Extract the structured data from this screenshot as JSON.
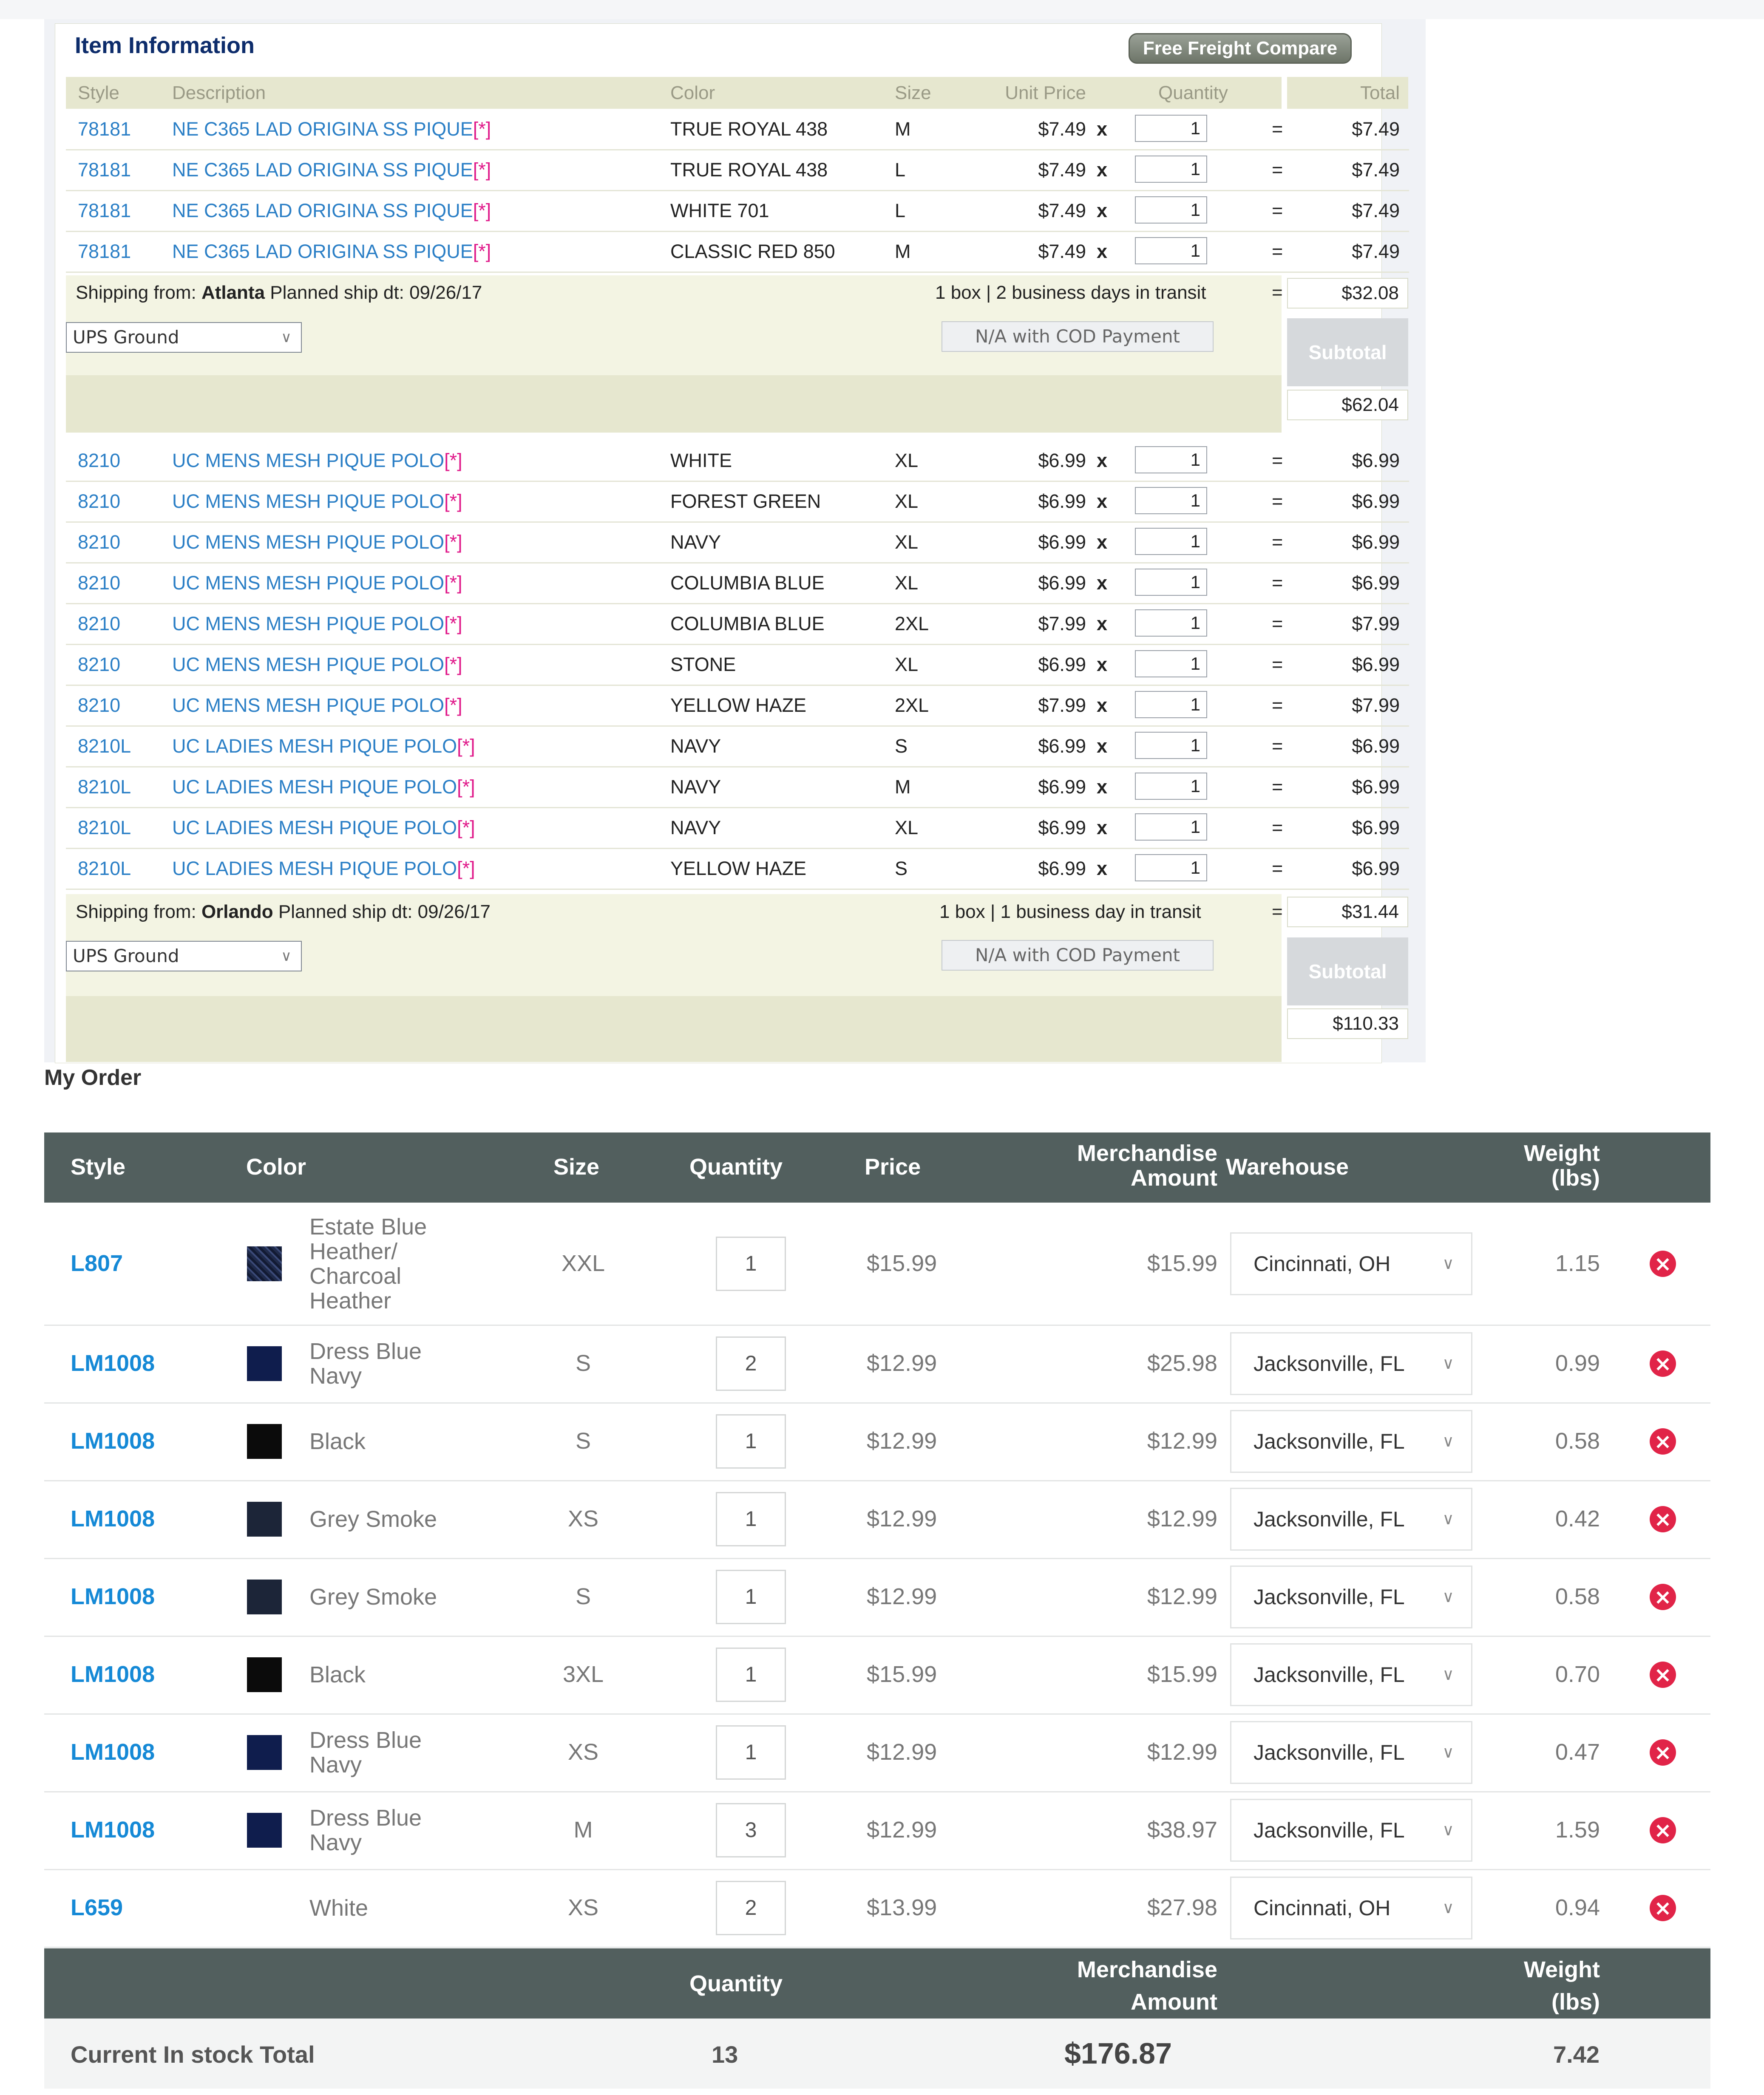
{
  "item_info": {
    "title": "Item Information",
    "ffc_button": "Free Freight Compare",
    "headers": [
      "Style",
      "Description",
      "Color",
      "Size",
      "Unit Price",
      "Quantity",
      "Total"
    ],
    "x_sign": "x",
    "eq_sign": "=",
    "asterisk": "[*]",
    "group1": {
      "rows": [
        {
          "style": "78181",
          "desc": "NE C365 LAD ORIGINA SS PIQUE",
          "color": "TRUE ROYAL 438",
          "size": "M",
          "price": "$7.49",
          "qty": "1",
          "total": "$7.49"
        },
        {
          "style": "78181",
          "desc": "NE C365 LAD ORIGINA SS PIQUE",
          "color": "TRUE ROYAL 438",
          "size": "L",
          "price": "$7.49",
          "qty": "1",
          "total": "$7.49"
        },
        {
          "style": "78181",
          "desc": "NE C365 LAD ORIGINA SS PIQUE",
          "color": "WHITE 701",
          "size": "L",
          "price": "$7.49",
          "qty": "1",
          "total": "$7.49"
        },
        {
          "style": "78181",
          "desc": "NE C365 LAD ORIGINA SS PIQUE",
          "color": "CLASSIC RED 850",
          "size": "M",
          "price": "$7.49",
          "qty": "1",
          "total": "$7.49"
        }
      ],
      "ship_prefix": "Shipping from: ",
      "ship_city": "Atlanta",
      "ship_dt": " Planned ship dt: 09/26/17",
      "transit": "1 box | 2 business days in transit",
      "ship_cost": "$32.08",
      "method": "UPS Ground",
      "cod": "N/A with COD Payment",
      "subtotal_label": "Subtotal",
      "subtotal": "$62.04"
    },
    "group2": {
      "rows": [
        {
          "style": "8210",
          "desc": "UC MENS MESH PIQUE POLO",
          "color": "WHITE",
          "size": "XL",
          "price": "$6.99",
          "qty": "1",
          "total": "$6.99"
        },
        {
          "style": "8210",
          "desc": "UC MENS MESH PIQUE POLO",
          "color": "FOREST GREEN",
          "size": "XL",
          "price": "$6.99",
          "qty": "1",
          "total": "$6.99"
        },
        {
          "style": "8210",
          "desc": "UC MENS MESH PIQUE POLO",
          "color": "NAVY",
          "size": "XL",
          "price": "$6.99",
          "qty": "1",
          "total": "$6.99"
        },
        {
          "style": "8210",
          "desc": "UC MENS MESH PIQUE POLO",
          "color": "COLUMBIA BLUE",
          "size": "XL",
          "price": "$6.99",
          "qty": "1",
          "total": "$6.99"
        },
        {
          "style": "8210",
          "desc": "UC MENS MESH PIQUE POLO",
          "color": "COLUMBIA BLUE",
          "size": "2XL",
          "price": "$7.99",
          "qty": "1",
          "total": "$7.99"
        },
        {
          "style": "8210",
          "desc": "UC MENS MESH PIQUE POLO",
          "color": "STONE",
          "size": "XL",
          "price": "$6.99",
          "qty": "1",
          "total": "$6.99"
        },
        {
          "style": "8210",
          "desc": "UC MENS MESH PIQUE POLO",
          "color": "YELLOW HAZE",
          "size": "2XL",
          "price": "$7.99",
          "qty": "1",
          "total": "$7.99"
        },
        {
          "style": "8210L",
          "desc": "UC LADIES MESH PIQUE POLO",
          "color": "NAVY",
          "size": "S",
          "price": "$6.99",
          "qty": "1",
          "total": "$6.99"
        },
        {
          "style": "8210L",
          "desc": "UC LADIES MESH PIQUE POLO",
          "color": "NAVY",
          "size": "M",
          "price": "$6.99",
          "qty": "1",
          "total": "$6.99"
        },
        {
          "style": "8210L",
          "desc": "UC LADIES MESH PIQUE POLO",
          "color": "NAVY",
          "size": "XL",
          "price": "$6.99",
          "qty": "1",
          "total": "$6.99"
        },
        {
          "style": "8210L",
          "desc": "UC LADIES MESH PIQUE POLO",
          "color": "YELLOW HAZE",
          "size": "S",
          "price": "$6.99",
          "qty": "1",
          "total": "$6.99"
        }
      ],
      "ship_prefix": "Shipping from: ",
      "ship_city": "Orlando",
      "ship_dt": " Planned ship dt: 09/26/17",
      "transit": "1 box | 1 business day in transit",
      "ship_cost": "$31.44",
      "method": "UPS Ground",
      "cod": "N/A with COD Payment",
      "subtotal_label": "Subtotal",
      "subtotal": "$110.33"
    }
  },
  "my_order": {
    "title": "My Order",
    "headers": {
      "style": "Style",
      "color": "Color",
      "size": "Size",
      "quantity": "Quantity",
      "price": "Price",
      "merch_1": "Merchandise",
      "merch_2": "Amount",
      "warehouse": "Warehouse",
      "weight_1": "Weight",
      "weight_2": "(lbs)"
    },
    "rows": [
      {
        "style": "L807",
        "color_lines": [
          "Estate Blue",
          "Heather/",
          "Charcoal",
          "Heather"
        ],
        "swatch": "#1f2a4a",
        "swatch_kind": "heather",
        "size": "XXL",
        "qty": "1",
        "price": "$15.99",
        "amount": "$15.99",
        "warehouse": "Cincinnati, OH",
        "weight": "1.15"
      },
      {
        "style": "LM1008",
        "color_lines": [
          "Dress Blue",
          "Navy"
        ],
        "swatch": "#0f1d4d",
        "swatch_kind": "solid",
        "size": "S",
        "qty": "2",
        "price": "$12.99",
        "amount": "$25.98",
        "warehouse": "Jacksonville, FL",
        "weight": "0.99"
      },
      {
        "style": "LM1008",
        "color_lines": [
          "Black"
        ],
        "swatch": "#0b0b0b",
        "swatch_kind": "solid",
        "size": "S",
        "qty": "1",
        "price": "$12.99",
        "amount": "$12.99",
        "warehouse": "Jacksonville, FL",
        "weight": "0.58"
      },
      {
        "style": "LM1008",
        "color_lines": [
          "Grey Smoke"
        ],
        "swatch": "#1c2538",
        "swatch_kind": "solid",
        "size": "XS",
        "qty": "1",
        "price": "$12.99",
        "amount": "$12.99",
        "warehouse": "Jacksonville, FL",
        "weight": "0.42"
      },
      {
        "style": "LM1008",
        "color_lines": [
          "Grey Smoke"
        ],
        "swatch": "#1c2538",
        "swatch_kind": "solid",
        "size": "S",
        "qty": "1",
        "price": "$12.99",
        "amount": "$12.99",
        "warehouse": "Jacksonville, FL",
        "weight": "0.58"
      },
      {
        "style": "LM1008",
        "color_lines": [
          "Black"
        ],
        "swatch": "#0b0b0b",
        "swatch_kind": "solid",
        "size": "3XL",
        "qty": "1",
        "price": "$15.99",
        "amount": "$15.99",
        "warehouse": "Jacksonville, FL",
        "weight": "0.70"
      },
      {
        "style": "LM1008",
        "color_lines": [
          "Dress Blue",
          "Navy"
        ],
        "swatch": "#0f1d4d",
        "swatch_kind": "solid",
        "size": "XS",
        "qty": "1",
        "price": "$12.99",
        "amount": "$12.99",
        "warehouse": "Jacksonville, FL",
        "weight": "0.47"
      },
      {
        "style": "LM1008",
        "color_lines": [
          "Dress Blue",
          "Navy"
        ],
        "swatch": "#0f1d4d",
        "swatch_kind": "solid",
        "size": "M",
        "qty": "3",
        "price": "$12.99",
        "amount": "$38.97",
        "warehouse": "Jacksonville, FL",
        "weight": "1.59"
      },
      {
        "style": "L659",
        "color_lines": [
          "White"
        ],
        "swatch": "#ffffff",
        "swatch_kind": "none",
        "size": "XS",
        "qty": "2",
        "price": "$13.99",
        "amount": "$27.98",
        "warehouse": "Cincinnati, OH",
        "weight": "0.94"
      }
    ],
    "footer": {
      "quantity": "Quantity",
      "merch_1": "Merchandise",
      "merch_2": "Amount",
      "weight_1": "Weight",
      "weight_2": "(lbs)"
    },
    "totals": {
      "label": "Current In stock Total",
      "quantity": "13",
      "amount": "$176.87",
      "weight": "7.42"
    },
    "icons": {
      "remove": "remove-circle-icon",
      "dropdown": "chevron-down-icon"
    },
    "colors": {
      "header_bg": "#525f5e",
      "style_link": "#1589d6",
      "remove": "#e12448",
      "item_link": "#2b7fc6",
      "asterisk": "#e0198a"
    }
  }
}
